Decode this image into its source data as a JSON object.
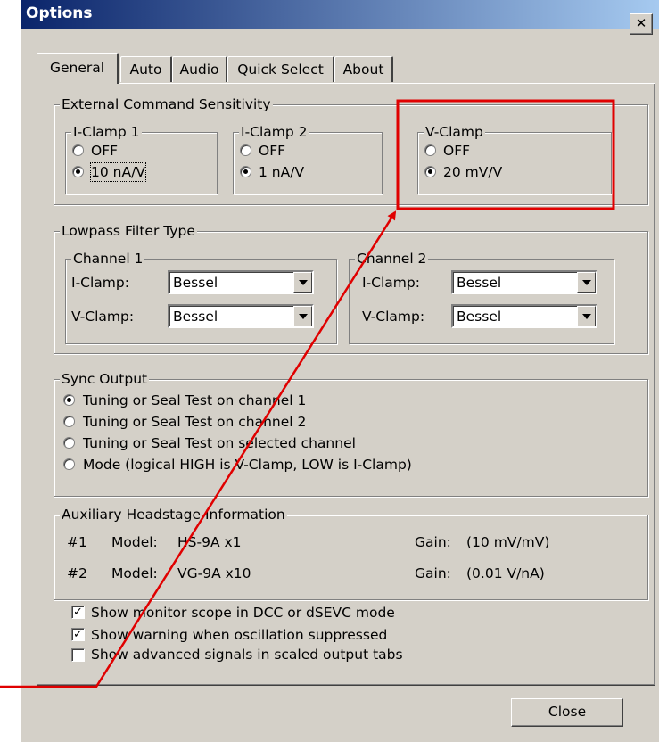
{
  "window": {
    "title": "Options",
    "close_glyph": "✕"
  },
  "tabs": [
    {
      "label": "General",
      "active": true
    },
    {
      "label": "Auto"
    },
    {
      "label": "Audio"
    },
    {
      "label": "Quick Select"
    },
    {
      "label": "About"
    }
  ],
  "ext_cmd": {
    "label": "External Command Sensitivity",
    "iclamp1": {
      "label": "I-Clamp 1",
      "opt_off": "OFF",
      "opt_on": "10 nA/V",
      "selected": "10 nA/V"
    },
    "iclamp2": {
      "label": "I-Clamp 2",
      "opt_off": "OFF",
      "opt_on": "1 nA/V",
      "selected": "1 nA/V"
    },
    "vclamp": {
      "label": "V-Clamp",
      "opt_off": "OFF",
      "opt_on": "20 mV/V",
      "selected": "20 mV/V"
    }
  },
  "lowpass": {
    "label": "Lowpass Filter Type",
    "channel1": {
      "label": "Channel 1",
      "iclamp_label": "I-Clamp:",
      "iclamp_value": "Bessel",
      "vclamp_label": "V-Clamp:",
      "vclamp_value": "Bessel"
    },
    "channel2": {
      "label": "Channel 2",
      "iclamp_label": "I-Clamp:",
      "iclamp_value": "Bessel",
      "vclamp_label": "V-Clamp:",
      "vclamp_value": "Bessel"
    }
  },
  "sync": {
    "label": "Sync Output",
    "options": [
      "Tuning or Seal Test on channel 1",
      "Tuning or Seal Test on channel 2",
      "Tuning or Seal Test on selected channel",
      "Mode (logical HIGH is V-Clamp, LOW is I-Clamp)"
    ],
    "selected_index": 0
  },
  "aux": {
    "label": "Auxiliary Headstage Information",
    "rows": [
      {
        "num": "#1",
        "model_label": "Model:",
        "model": "HS-9A x1",
        "gain_label": "Gain:",
        "gain": "(10 mV/mV)"
      },
      {
        "num": "#2",
        "model_label": "Model:",
        "model": "VG-9A x10",
        "gain_label": "Gain:",
        "gain": "(0.01 V/nA)"
      }
    ]
  },
  "checks": [
    {
      "label": "Show monitor scope in DCC or dSEVC mode",
      "checked": true
    },
    {
      "label": "Show warning when oscillation suppressed",
      "checked": true
    },
    {
      "label": "Show advanced signals in scaled output tabs",
      "checked": false
    }
  ],
  "close_button": "Close",
  "annotation": {
    "color": "#e00000"
  }
}
